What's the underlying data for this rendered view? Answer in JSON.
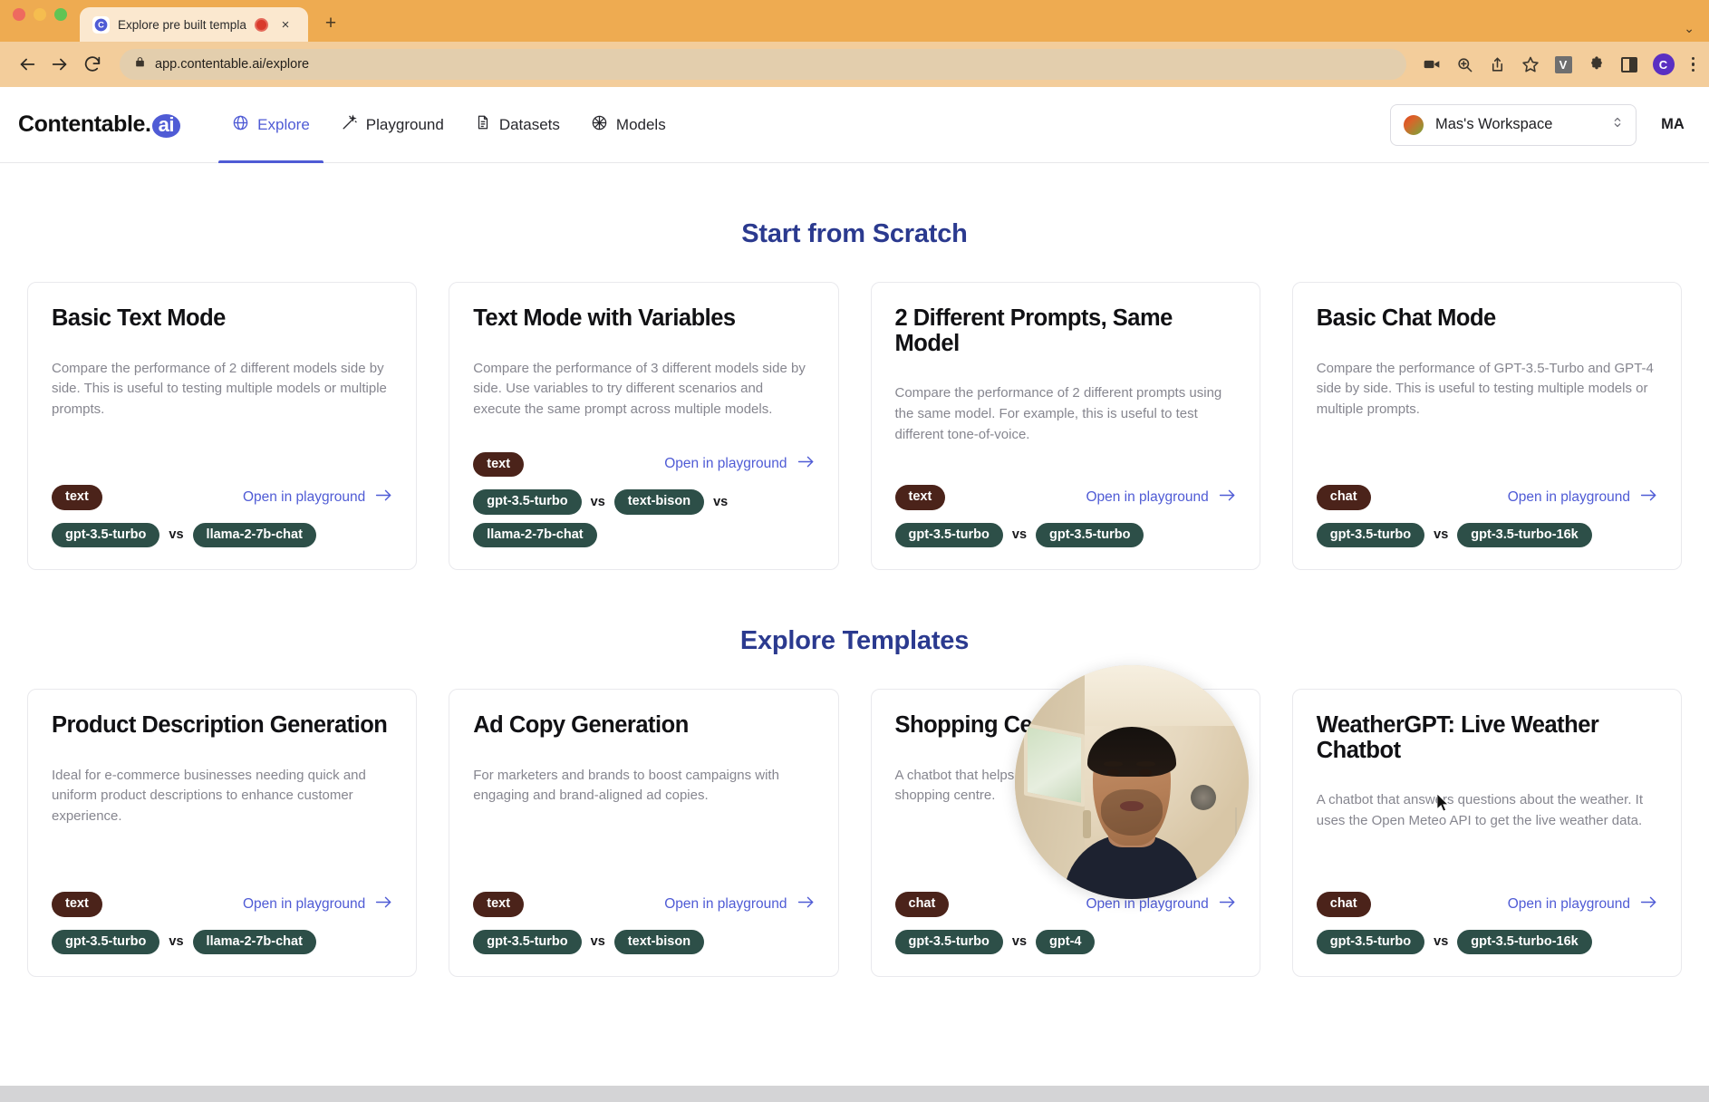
{
  "browser": {
    "tab": {
      "title": "Explore pre built templates",
      "favicon_letter": "C",
      "recording_indicator": "recording-dot",
      "close_label": "×"
    },
    "new_tab_label": "+",
    "tabstrip_right_chevron": "⌄",
    "toolbar": {
      "back_label": "←",
      "forward_label": "→",
      "reload_label": "⟳",
      "lock_icon": "lock-icon",
      "url": "app.contentable.ai/explore",
      "icons": [
        "video-camera-icon",
        "zoom-search-icon",
        "share-icon",
        "star-icon"
      ],
      "vimium_badge": "V",
      "extensions_icon": "puzzle-piece-icon",
      "side_panel_icon": "side-panel-icon",
      "profile_initial": "C",
      "menu_icon": "three-dots-icon"
    }
  },
  "app": {
    "brand": {
      "name": "Contentable",
      "dot": ".",
      "suffix": "ai"
    },
    "nav": [
      {
        "id": "explore",
        "label": "Explore",
        "icon": "globe-icon",
        "active": true
      },
      {
        "id": "playground",
        "label": "Playground",
        "icon": "magic-wand-icon",
        "active": false
      },
      {
        "id": "datasets",
        "label": "Datasets",
        "icon": "document-icon",
        "active": false
      },
      {
        "id": "models",
        "label": "Models",
        "icon": "sphere-icon",
        "active": false
      }
    ],
    "workspace": {
      "name": "Mas's Workspace",
      "chevron": "⌃⌄"
    },
    "user_initials": "MA"
  },
  "sections": {
    "start_from_scratch": {
      "title": "Start from Scratch",
      "cards": [
        {
          "title": "Basic Text Mode",
          "description": "Compare the performance of 2 different models side by side. This is useful to testing multiple models or multiple prompts.",
          "mode": "text",
          "cta": "Open in playground",
          "models": [
            "gpt-3.5-turbo",
            "llama-2-7b-chat"
          ]
        },
        {
          "title": "Text Mode with Variables",
          "description": "Compare the performance of 3 different models side by side. Use variables to try different scenarios and execute the same prompt across multiple models.",
          "mode": "text",
          "cta": "Open in playground",
          "models": [
            "gpt-3.5-turbo",
            "text-bison",
            "llama-2-7b-chat"
          ]
        },
        {
          "title": "2 Different Prompts, Same Model",
          "description": "Compare the performance of 2 different prompts using the same model. For example, this is useful to test different tone-of-voice.",
          "mode": "text",
          "cta": "Open in playground",
          "models": [
            "gpt-3.5-turbo",
            "gpt-3.5-turbo"
          ]
        },
        {
          "title": "Basic Chat Mode",
          "description": "Compare the performance of GPT-3.5-Turbo and GPT-4 side by side. This is useful to testing multiple models or multiple prompts.",
          "mode": "chat",
          "cta": "Open in playground",
          "models": [
            "gpt-3.5-turbo",
            "gpt-3.5-turbo-16k"
          ]
        }
      ]
    },
    "explore_templates": {
      "title": "Explore Templates",
      "cards": [
        {
          "title": "Product Description Generation",
          "description": "Ideal for e-commerce businesses needing quick and uniform product descriptions to enhance customer experience.",
          "mode": "text",
          "cta": "Open in playground",
          "models": [
            "gpt-3.5-turbo",
            "llama-2-7b-chat"
          ]
        },
        {
          "title": "Ad Copy Generation",
          "description": "For marketers and brands to boost campaigns with engaging and brand-aligned ad copies.",
          "mode": "text",
          "cta": "Open in playground",
          "models": [
            "gpt-3.5-turbo",
            "text-bison"
          ]
        },
        {
          "title": "Shopping Centre Chatbot",
          "description": "A chatbot that helps customers find the right product in a shopping centre.",
          "mode": "chat",
          "cta": "Open in playground",
          "models": [
            "gpt-3.5-turbo",
            "gpt-4"
          ]
        },
        {
          "title": "WeatherGPT: Live Weather Chatbot",
          "description": "A chatbot that answers questions about the weather. It uses the Open Meteo API to get the live weather data.",
          "mode": "chat",
          "cta": "Open in playground",
          "models": [
            "gpt-3.5-turbo",
            "gpt-3.5-turbo-16k"
          ]
        }
      ]
    }
  },
  "labels": {
    "vs": "vs",
    "arrow": "→"
  },
  "colors": {
    "accent": "#4f5bd5",
    "section_title": "#2b3a8f",
    "mode_pill": "#4b231a",
    "model_pill": "#2d4f48",
    "browser_chrome": "#eeab51",
    "toolbar": "#f3cd9b"
  },
  "overlay": {
    "webcam": "webcam-circle-overlay"
  }
}
